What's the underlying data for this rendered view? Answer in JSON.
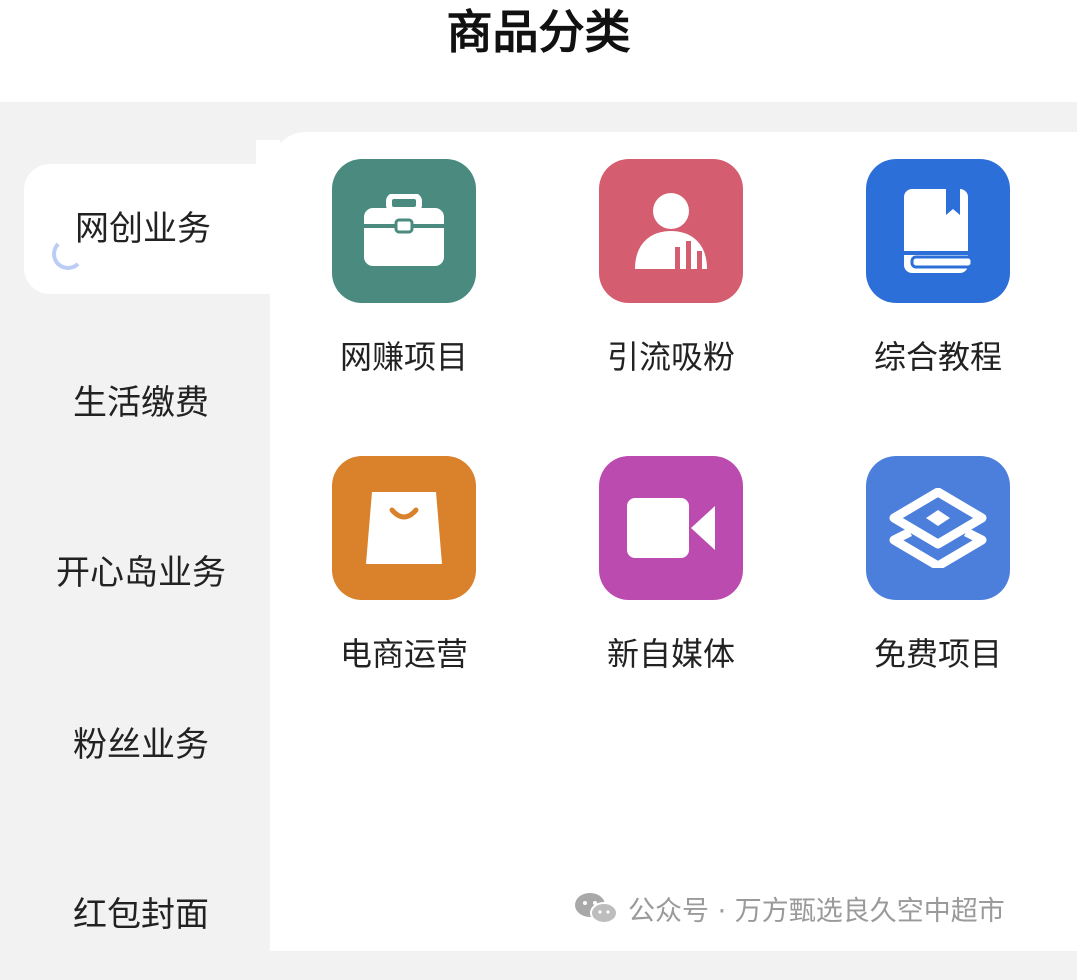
{
  "header": {
    "title": "商品分类"
  },
  "sidebar": {
    "items": [
      {
        "label": "网创业务",
        "active": true
      },
      {
        "label": "生活缴费",
        "active": false
      },
      {
        "label": "开心岛业务",
        "active": false
      },
      {
        "label": "粉丝业务",
        "active": false
      },
      {
        "label": "红包封面",
        "active": false
      }
    ]
  },
  "categories": [
    {
      "label": "网赚项目",
      "icon": "briefcase-icon",
      "color": "#4a8a7f"
    },
    {
      "label": "引流吸粉",
      "icon": "user-icon",
      "color": "#d45d6f"
    },
    {
      "label": "综合教程",
      "icon": "book-icon",
      "color": "#2d6fd8"
    },
    {
      "label": "电商运营",
      "icon": "shopping-bag-icon",
      "color": "#d9822b"
    },
    {
      "label": "新自媒体",
      "icon": "video-camera-icon",
      "color": "#bb4baf"
    },
    {
      "label": "免费项目",
      "icon": "layers-icon",
      "color": "#4c7fdc"
    }
  ],
  "watermark": {
    "text": "公众号 · 万方甄选良久空中超市"
  },
  "colors": {
    "sidebar_bg": "#f2f2f2",
    "active_indicator": "#bccdf5"
  }
}
